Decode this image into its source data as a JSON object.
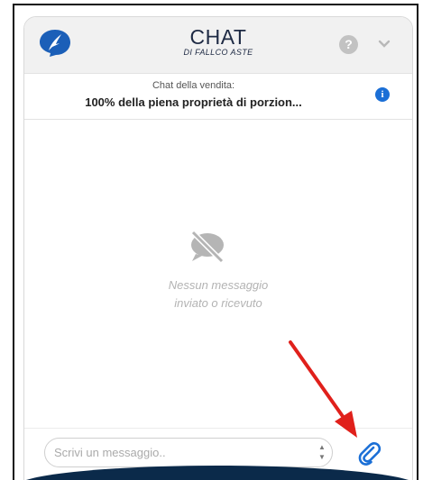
{
  "header": {
    "title": "CHAT",
    "subtitle": "DI FALLCO ASTE",
    "logo_icon": "fallco-bird-logo",
    "help_icon": "question-icon",
    "collapse_icon": "chevron-down-icon"
  },
  "sale": {
    "label": "Chat della vendita:",
    "value": "100% della piena proprietà di porzion...",
    "info_icon": "info-icon"
  },
  "messages": {
    "empty_icon": "no-comment-icon",
    "empty_line1": "Nessun messaggio",
    "empty_line2": "inviato o ricevuto"
  },
  "composer": {
    "placeholder": "Scrivi un messaggio..",
    "attach_icon": "paperclip-icon"
  },
  "colors": {
    "brand_blue": "#1b6fd6",
    "navy": "#1e2a44",
    "annotation_red": "#e0201b"
  }
}
